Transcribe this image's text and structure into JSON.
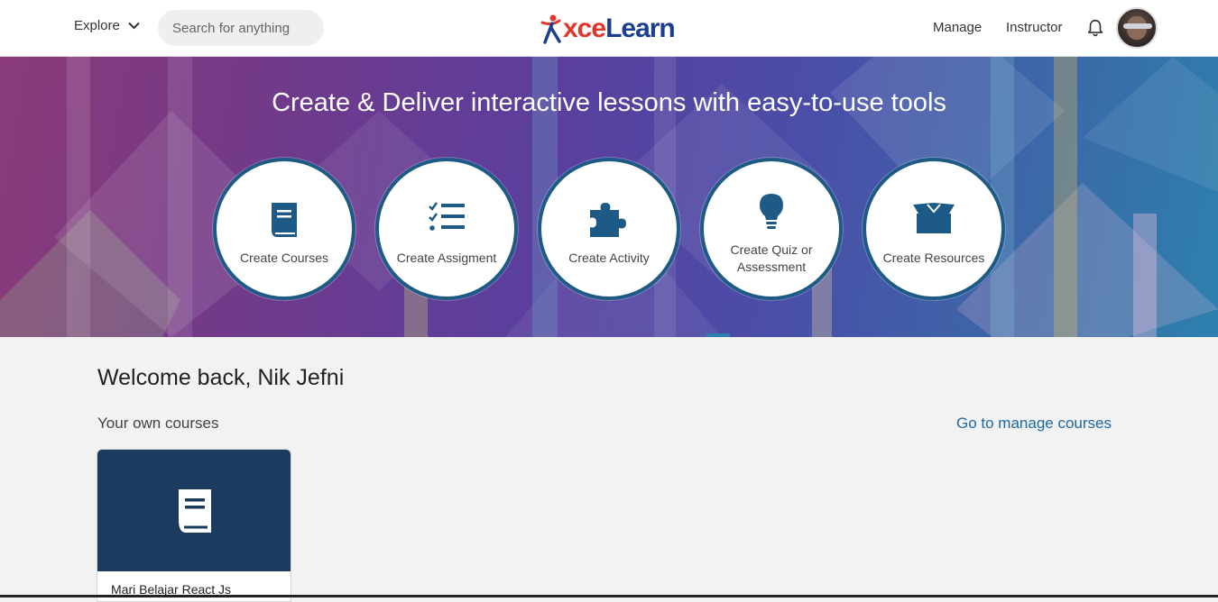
{
  "header": {
    "explore_label": "Explore",
    "search_placeholder": "Search for anything",
    "logo_x": "X",
    "logo_rest": "celearn",
    "nav_manage": "Manage",
    "nav_instructor": "Instructor",
    "avatar_icon": "user-avatar"
  },
  "hero": {
    "title": "Create & Deliver interactive lessons with easy-to-use tools",
    "tiles": [
      {
        "label": "Create Courses",
        "icon": "book-icon"
      },
      {
        "label": "Create Assigment",
        "icon": "checklist-icon"
      },
      {
        "label": "Create Activity",
        "icon": "puzzle-icon"
      },
      {
        "label_line1": "Create Quiz or",
        "label_line2": "Assessment",
        "icon": "lightbulb-icon"
      },
      {
        "label": "Create Resources",
        "icon": "open-box-icon"
      }
    ]
  },
  "main": {
    "welcome": "Welcome back, Nik Jefni",
    "section_title": "Your own courses",
    "manage_link": "Go to manage courses",
    "courses": [
      {
        "title": "Mari Belajar React Js",
        "icon": "book-icon"
      }
    ]
  },
  "colors": {
    "accent": "#1d5b86",
    "link": "#1e6aa3",
    "card_thumb": "#1b3c5e",
    "logo_red": "#e0362c",
    "logo_blue": "#1b3f8f"
  }
}
